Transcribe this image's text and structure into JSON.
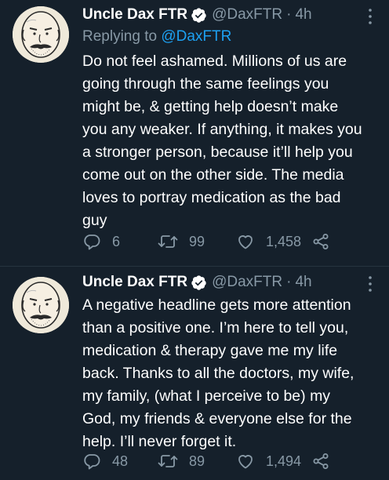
{
  "tweets": [
    {
      "author": {
        "display_name": "Uncle Dax FTR",
        "handle": "@DaxFTR",
        "verified": true,
        "avatar_icon": "cartoon-bald-bearded-man-avatar"
      },
      "separator": "·",
      "time": "4h",
      "reply": {
        "prefix": "Replying to",
        "handle": "@DaxFTR"
      },
      "text_lines": [
        "Do not feel ashamed. Millions of us are",
        "going through the same feelings you",
        "might be, & getting help doesn’t make",
        "you any weaker. If anything, it makes you",
        "a stronger person, because it’ll help you",
        "come out on the other side. The media",
        "loves to portray medication as the bad",
        "guy"
      ],
      "stats": {
        "replies": "6",
        "retweets": "99",
        "likes": "1,458"
      }
    },
    {
      "author": {
        "display_name": "Uncle Dax FTR",
        "handle": "@DaxFTR",
        "verified": true,
        "avatar_icon": "cartoon-bald-bearded-man-avatar"
      },
      "separator": "·",
      "time": "4h",
      "text_lines": [
        "A negative headline gets more attention",
        "than a positive one. I’m here to tell you,",
        "medication & therapy gave me my life",
        "back. Thanks to all the doctors, my wife,",
        "my family, (what I perceive to be) my",
        "God, my friends & everyone else for the",
        "help. I’ll never forget it."
      ],
      "stats": {
        "replies": "48",
        "retweets": "89",
        "likes": "1,494"
      }
    }
  ],
  "icons": {
    "reply": "reply-icon",
    "retweet": "retweet-icon",
    "like": "heart-icon",
    "share": "share-icon",
    "more": "more-vertical-icon",
    "verified": "verified-badge-icon"
  },
  "colors": {
    "background": "#15202b",
    "primary_text": "#ffffff",
    "secondary_text": "#8899a6",
    "link": "#1da1f2",
    "divider": "#26343f"
  }
}
